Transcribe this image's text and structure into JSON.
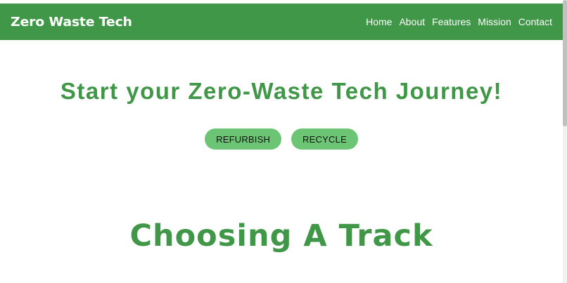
{
  "header": {
    "brand": "Zero Waste Tech",
    "nav": [
      {
        "label": "Home"
      },
      {
        "label": "About"
      },
      {
        "label": "Features"
      },
      {
        "label": "Mission"
      },
      {
        "label": "Contact"
      }
    ]
  },
  "hero": {
    "title": "Start your Zero-Waste Tech Journey!",
    "buttons": [
      {
        "label": "REFURBISH"
      },
      {
        "label": "RECYCLE"
      }
    ]
  },
  "section": {
    "title": "Choosing A Track"
  },
  "colors": {
    "brand_green": "#3f9747",
    "button_green": "#6cc574"
  }
}
